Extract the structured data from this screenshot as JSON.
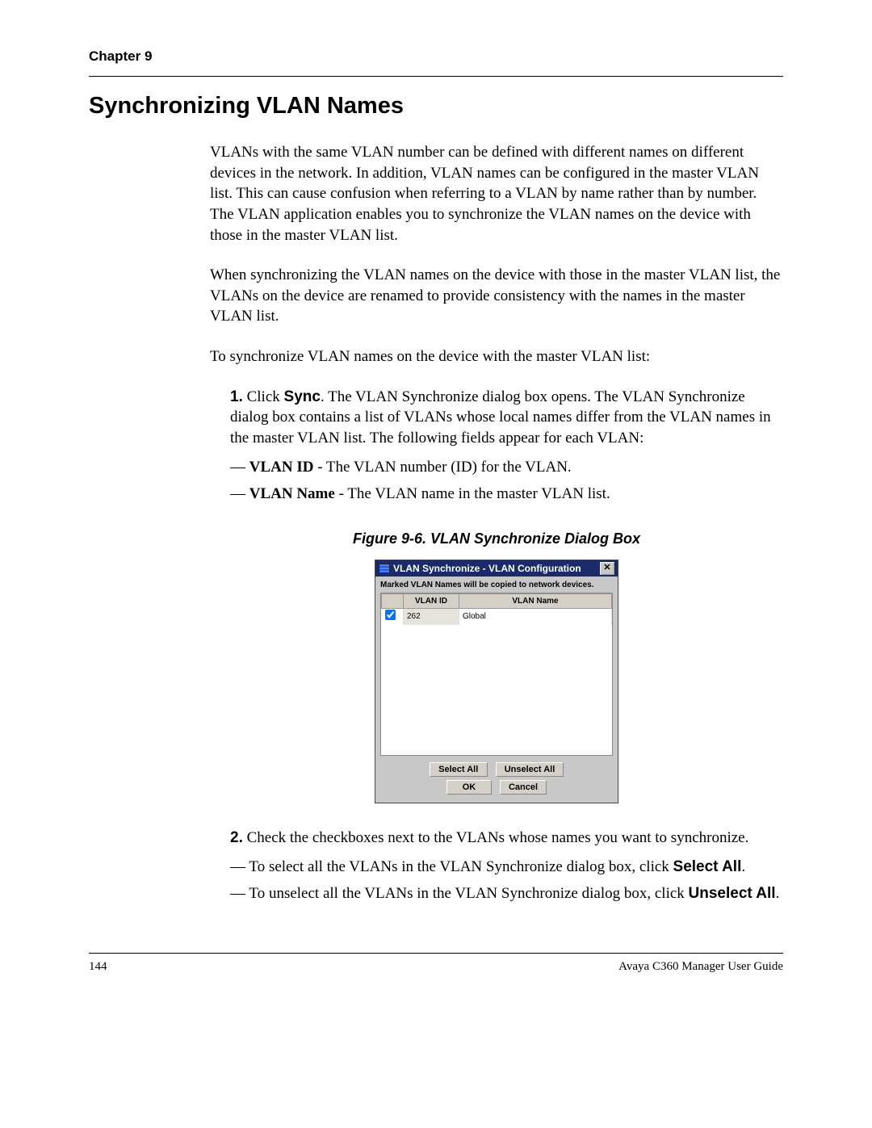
{
  "header": {
    "chapter": "Chapter 9"
  },
  "title": "Synchronizing VLAN Names",
  "paragraphs": {
    "p1": "VLANs with the same VLAN number can be defined with different names on different devices in the network. In addition, VLAN names can be configured in the master VLAN list. This can cause confusion when referring to a VLAN by name rather than by number. The VLAN application enables you to synchronize the VLAN names on the device with those in the master VLAN list.",
    "p2": "When synchronizing the VLAN names on the device with those in the master VLAN list, the VLANs on the device are renamed to provide consistency with the names in the master VLAN list.",
    "p3": "To synchronize VLAN names on the device with the master VLAN list:"
  },
  "step1": {
    "num": "1.",
    "pre": " Click ",
    "bold": "Sync",
    "post": ". The VLAN Synchronize dialog box opens. The VLAN Synchronize dialog box contains a list of VLANs whose local names differ from the VLAN names in the master VLAN list. The following fields appear for each VLAN:",
    "sub1_dash": "— ",
    "sub1_bold": "VLAN ID",
    "sub1_rest": " - The VLAN number (ID) for the VLAN.",
    "sub2_dash": "— ",
    "sub2_bold": "VLAN Name",
    "sub2_rest": " - The VLAN name in the master VLAN list."
  },
  "figure": {
    "caption": "Figure 9-6. VLAN Synchronize Dialog Box"
  },
  "dialog": {
    "title": "VLAN Synchronize - VLAN Configuration",
    "close": "✕",
    "message": "Marked VLAN Names will be copied to network devices.",
    "headers": {
      "chk": "",
      "id": "VLAN ID",
      "name": "VLAN Name"
    },
    "row": {
      "id": "262",
      "name": "Global"
    },
    "buttons": {
      "select_all": "Select All",
      "unselect_all": "Unselect All",
      "ok": "OK",
      "cancel": "Cancel"
    }
  },
  "step2": {
    "num": "2.",
    "text": " Check the checkboxes next to the VLANs whose names you want to synchronize.",
    "sub1_dash": "— ",
    "sub1_pre": "To select all the VLANs in the VLAN Synchronize dialog box, click ",
    "sub1_bold": "Select All",
    "sub1_post": ".",
    "sub2_dash": "— ",
    "sub2_pre": "To unselect all the VLANs in the VLAN Synchronize dialog box, click ",
    "sub2_bold": "Unselect All",
    "sub2_post": "."
  },
  "footer": {
    "page": "144",
    "guide": "Avaya C360 Manager User Guide"
  }
}
